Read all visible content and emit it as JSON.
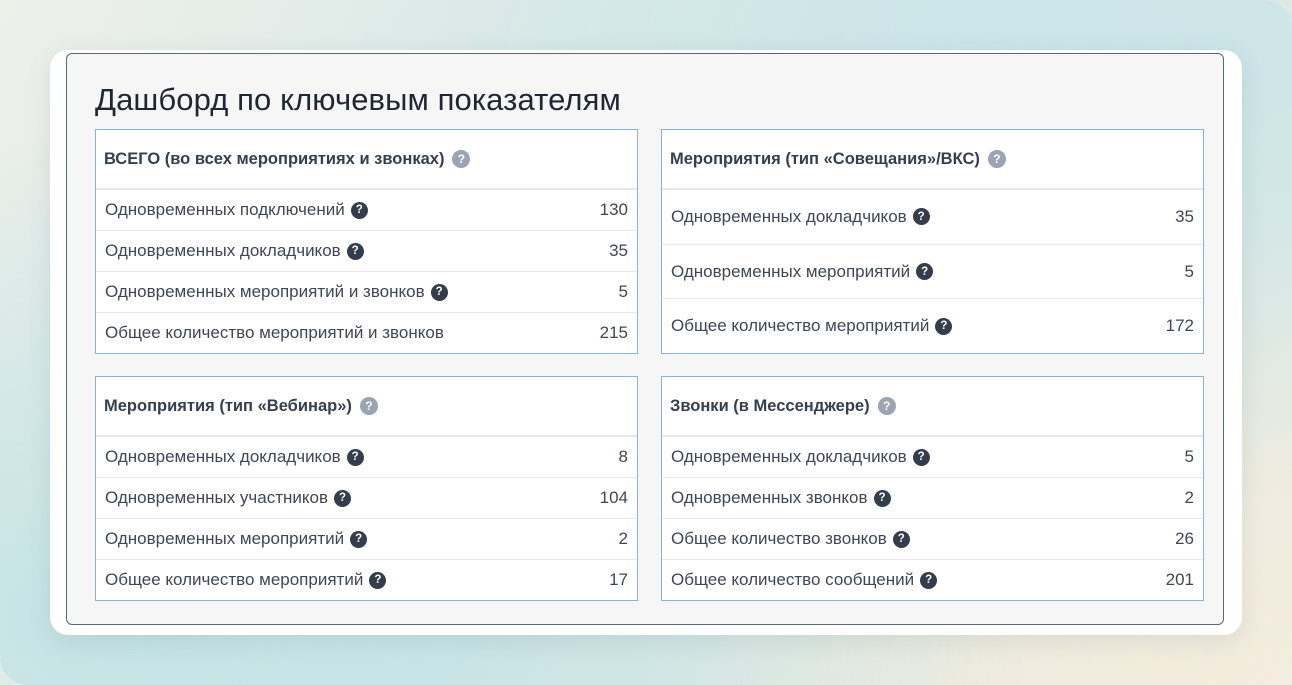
{
  "page": {
    "title": "Дашборд по ключевым показателям"
  },
  "icons": {
    "help": "?"
  },
  "cards": {
    "total": {
      "title": "ВСЕГО (во всех мероприятиях и звонках)",
      "rows": [
        {
          "label": "Одновременных подключений",
          "value": "130",
          "has_help": true
        },
        {
          "label": "Одновременных докладчиков",
          "value": "35",
          "has_help": true
        },
        {
          "label": "Одновременных мероприятий и звонков",
          "value": "5",
          "has_help": true
        },
        {
          "label": "Общее количество мероприятий и звонков",
          "value": "215",
          "has_help": false
        }
      ]
    },
    "meetings": {
      "title": "Мероприятия (тип «Совещания»/ВКС)",
      "rows": [
        {
          "label": "Одновременных докладчиков",
          "value": "35",
          "has_help": true
        },
        {
          "label": "Одновременных мероприятий",
          "value": "5",
          "has_help": true
        },
        {
          "label": "Общее количество мероприятий",
          "value": "172",
          "has_help": true
        }
      ]
    },
    "webinar": {
      "title": "Мероприятия (тип «Вебинар»)",
      "rows": [
        {
          "label": "Одновременных докладчиков",
          "value": "8",
          "has_help": true
        },
        {
          "label": "Одновременных участников",
          "value": "104",
          "has_help": true
        },
        {
          "label": "Одновременных мероприятий",
          "value": "2",
          "has_help": true
        },
        {
          "label": "Общее количество мероприятий",
          "value": "17",
          "has_help": true
        }
      ]
    },
    "calls": {
      "title": "Звонки (в Мессенджере)",
      "rows": [
        {
          "label": "Одновременных докладчиков",
          "value": "5",
          "has_help": true
        },
        {
          "label": "Одновременных звонков",
          "value": "2",
          "has_help": true
        },
        {
          "label": "Общее количество звонков",
          "value": "26",
          "has_help": true
        },
        {
          "label": "Общее количество сообщений",
          "value": "201",
          "has_help": true
        }
      ]
    }
  }
}
